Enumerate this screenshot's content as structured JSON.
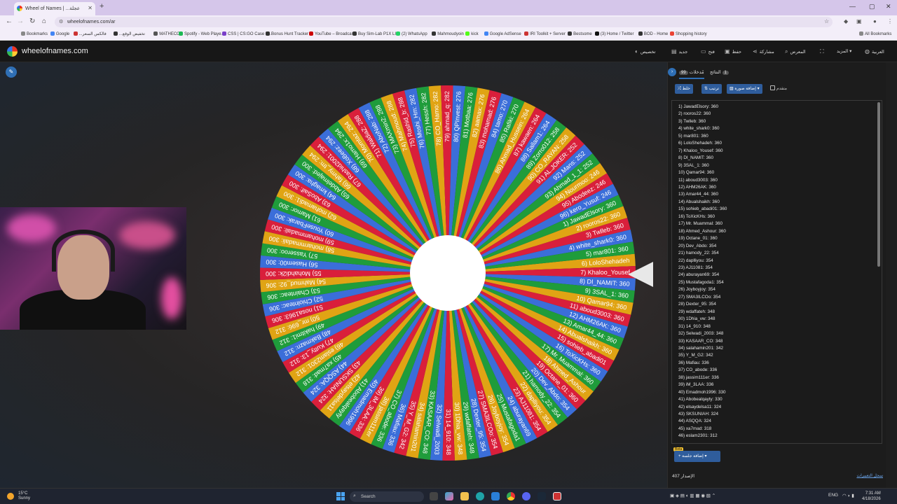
{
  "browser": {
    "tab_title": "Wheel of Names | ...عجلة",
    "url": "wheelofnames.com/ar",
    "bookmarks": [
      "Bookmarks",
      "Google",
      "...فالكس السعر",
      "...تخفيض الوقع",
      "MATHECO",
      "Spotify - Web Playe...",
      "CSS | CS:GO Case O...",
      "Bonus Hunt Tracker",
      "YouTube – Broadcas...",
      "Buy Sim-Lab P1X LI...",
      "(2) WhatsApp",
      "Mahmoudyoin",
      "kick",
      "Google AdSense",
      "IRI Toolkit + Server",
      "Bestsome",
      "(3) Home / Twitter",
      "BOD - Home",
      "Shopping history",
      "All Bookmarks"
    ]
  },
  "app": {
    "logo_text": "wheelofnames.com",
    "menu": {
      "customize": "تخصيص",
      "new": "جديد",
      "open": "فتح",
      "save": "حفظ",
      "share": "مشاركة",
      "gallery": "المعرض",
      "fullscreen": "",
      "more": "المزيد",
      "language": "العربية"
    }
  },
  "sidebar": {
    "tab_entries": "مُدخلات",
    "tab_entries_count": "99",
    "tab_results": "النتائج",
    "tab_results_count": "1",
    "shuffle": "خلط",
    "sort": "ترتيب",
    "add_image": "إضافة صورة",
    "advanced": "متقدم",
    "beta": "Beta",
    "launch": "إضافة جلسة",
    "version": "الإصدار 407",
    "changelog": "سجل التغييرات"
  },
  "entries": [
    "1) JawadElsory: 360",
    "2) rooros22: 360",
    "3) Twlleb: 360",
    "4) white_shark0: 360",
    "5) mar801: 360",
    "6) LoloShehadeh: 360",
    "7) Khaloo_Yousef: 360",
    "8) DI_NAMIT: 360",
    "9) 3SAL_1: 360",
    "10) Qamar94: 360",
    "11) aboud3003: 360",
    "12) AHM26AK: 360",
    "13) Amar44_44: 360",
    "14) Abualshaikh: 360",
    "15) sohieb_abadi01: 360",
    "16) ToXicKHs: 360",
    "17) Mr. Muammal: 360",
    "18) Ahmed_Ashour: 360",
    "19) Octane_01: 360",
    "20) Dev_Abdo: 354",
    "21) hamody_22: 354",
    "22) daplliyou: 354",
    "23) AJ11081: 354",
    "24) aburayan69: 354",
    "25) Mustafagoda1: 354",
    "26) Joyboyjoy: 354",
    "27) SMA3ILCOo: 354",
    "28) Dexter_95: 354",
    "29) wdaffateh: 348",
    "30) 1Dhia_vw: 348",
    "31) 14_910: 348",
    "32) Selwadi_2003: 348",
    "33) KASAAR_CO: 348",
    "34) salahamin201: 342",
    "35) Y_M_G2: 342",
    "36) Mafiau: 336",
    "37) CO_abode: 336",
    "38) jassim111er: 336",
    "39) iM_3LAA: 336",
    "40) Emadmoh1996: 330",
    "41) Abobealqayty: 330",
    "42) elsaydelsa11: 324",
    "43) SKSUNIAH: 324",
    "44) ASQQA: 324",
    "45) xa7mad: 318",
    "46) eslam2301: 312"
  ],
  "wheel_labels": [
    "6) LoloShehadeh",
    "7) Khaloo_Yousef",
    "8) DI_NAMIT: 360",
    "9) 3SAL_1: 360",
    "10) Qamar94: 360",
    "11) aboud3003: 360",
    "12) AHM26AK: 360",
    "13) Amar44_44: 360",
    "14) Abualshaikh: 360",
    "15) sohieb_abadi01",
    "16) ToXicKHs: 360",
    "17) Mr. Muammal: 360",
    "18) Ahmed_Ashour",
    "19) Octane_01: 360",
    "20) Dev_Abdo: 354",
    "21) hamody_22: 354",
    "22) daplliyou: 354",
    "23) AJ11081: 354",
    "24) aburayan69",
    "25) Mustafagoda1",
    "26) Joyboyjoy: 354",
    "27) SMA3ILCOo: 354",
    "28) Dexter_95: 354",
    "29) wdaffateh: 348",
    "30) 1Dhia_vw: 348",
    "31) 14_910: 348",
    "32) Selwadi_2003",
    "33) KASAAR_CO: 348",
    "34) salahamin201",
    "35) Y_M_G2: 342",
    "36) Mafiau: 336",
    "37) CO_abode: 336",
    "38) jassim111er",
    "39) iM_3LAA: 336",
    "40) Emadmoh1996",
    "41) Abobealqayty",
    "42) elsaydelsa11",
    "43) SKSUNIAH: 324",
    "44) ASQQA: 324",
    "45) xa7mad: 318",
    "46) eslam2301: 312",
    "47) Kutty_13: 312",
    "48) Bakmazn: 312",
    "49) hakitmi1: 312",
    "50) mr_696: 312",
    "51) nosa1963: 306",
    "52) Chiolnteac: 306",
    "53) Chainteac: 306",
    "54) Mahmud_92: 306",
    "55) Mohahdi2k: 300",
    "56) Hasem00: 300",
    "57) Yasseroo: 300",
    "58) moharmmadali: 300",
    "59) mohammadali: 300",
    "60) YouseFbarak: 300",
    "61) Mamor: 300",
    "62) mohamadi1: 300",
    "63) AboSaif: 300",
    "64) kmagha: 300",
    "65) Abdelmajed: 300",
    "66) fahmy_tm: 294",
    "67) Rashid2001: 294",
    "68) XoBeez: 294",
    "69) Hamo1x: 294",
    "70) Momtaz: 294",
    "71) WaldiaZ: 288",
    "72) AboNab: 288",
    "73) MAXmin2: 288",
    "74) Mahmoud: 288",
    "75) Rashid_b: 288",
    "76) Moshi_Hm: 282",
    "77) Hessh: 282",
    "78) CO_Hamo: 282",
    "79) ahmad_q: 282",
    "80) QPInvest: 276",
    "81) Motbaa: 276",
    "82) aamax: 276",
    "83) mohamad: 276",
    "84) tamo: 270",
    "85) Rafiki: 270",
    "86) Ahmad_Hussein: 264",
    "87) kawaen: 264",
    "88) Sallam1: 264",
    "89) Zorro012: 258",
    "90) CO_RAYAN: 258",
    "91) AL.JOKER: 252",
    "92) Mans: 252",
    "93) Ahmad_1_1: 252",
    "94) Nourmoo: 246",
    "95) Abodeez: 246",
    "96) kero_Yusuf: 246",
    "1) JawadElsory: 360",
    "2) rooros22: 360",
    "3) Twlleb: 360",
    "4) white_shark0: 360",
    "5) mar801: 360"
  ],
  "wheel_colors": [
    "#e0a414",
    "#d91f3b",
    "#3b6ed9",
    "#1f9c3b"
  ],
  "taskbar": {
    "temp": "15°C",
    "weather": "Sunny",
    "search": "Search",
    "lang": "ENG",
    "time": "7:31 AM",
    "date": "4/18/2026"
  }
}
